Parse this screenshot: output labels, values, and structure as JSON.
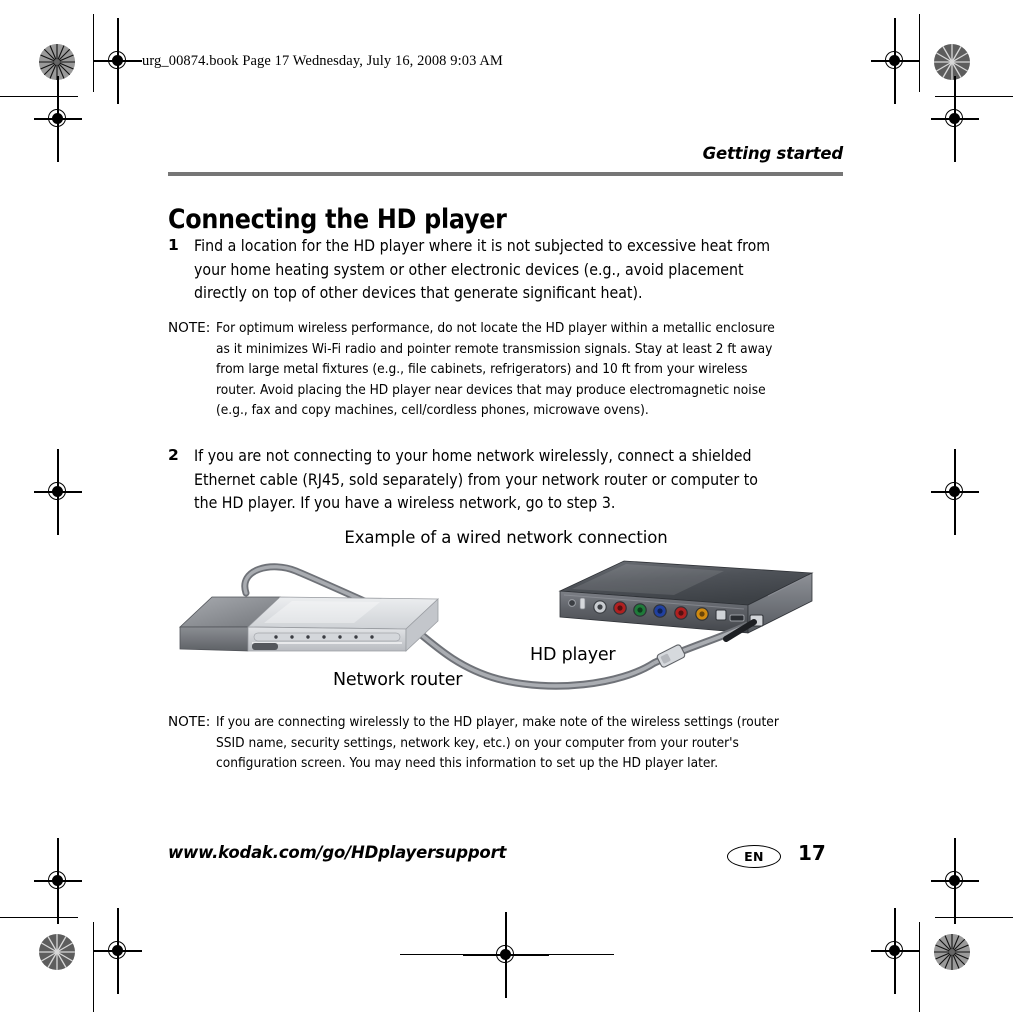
{
  "print_header": {
    "text": "urg_00874.book  Page 17  Wednesday, July 16, 2008  9:03 AM"
  },
  "running_head": {
    "text": "Getting started"
  },
  "chapter": {
    "title": "Connecting the HD player"
  },
  "steps": [
    {
      "number": "1",
      "text": "Find a location for the HD player where it is not subjected to excessive heat from your home heating system or other electronic devices (e.g., avoid placement directly on top of other devices that generate significant heat)."
    },
    {
      "number": "2",
      "text": "If you are not connecting to your home network wirelessly, connect a shielded Ethernet cable (RJ45, sold separately) from your network router or computer to the HD player. If you have a wireless network, go to step 3."
    }
  ],
  "notes": [
    {
      "label": "NOTE:",
      "text": "For optimum wireless performance, do not locate the HD player within a metallic enclosure as it minimizes Wi-Fi radio and pointer remote transmission signals. Stay at least 2 ft away from large metal fixtures (e.g., file cabinets, refrigerators) and 10 ft from your wireless router. Avoid placing the HD player near devices that may produce electromagnetic noise (e.g., fax and copy machines, cell/cordless phones, microwave ovens)."
    },
    {
      "label": "NOTE:",
      "text": "If you are connecting wirelessly to the HD player, make note of the wireless settings (router SSID name, security settings, network key, etc.) on your computer from your router's configuration screen. You may need this information to set up the HD player later."
    }
  ],
  "figure": {
    "caption": "Example of a wired network connection",
    "labels": {
      "router": "Network router",
      "player": "HD player"
    },
    "colors": {
      "router_top": "#d9dadd",
      "router_dark": "#6f7277",
      "player_body": "#4c4f54",
      "player_top": "#5a5e64",
      "cable": "#9a9da2",
      "jack_white": "#dcdcdc",
      "jack_red": "#b02020",
      "jack_green": "#1f7a3a",
      "jack_blue": "#2040a0",
      "jack_yellow": "#d08a10"
    }
  },
  "footer": {
    "url": "www.kodak.com/go/HDplayersupport",
    "language_badge": "EN",
    "page_number": "17"
  },
  "theme": {
    "rule_gray": "#767676",
    "text_black": "#000000",
    "page_background": "#ffffff"
  }
}
